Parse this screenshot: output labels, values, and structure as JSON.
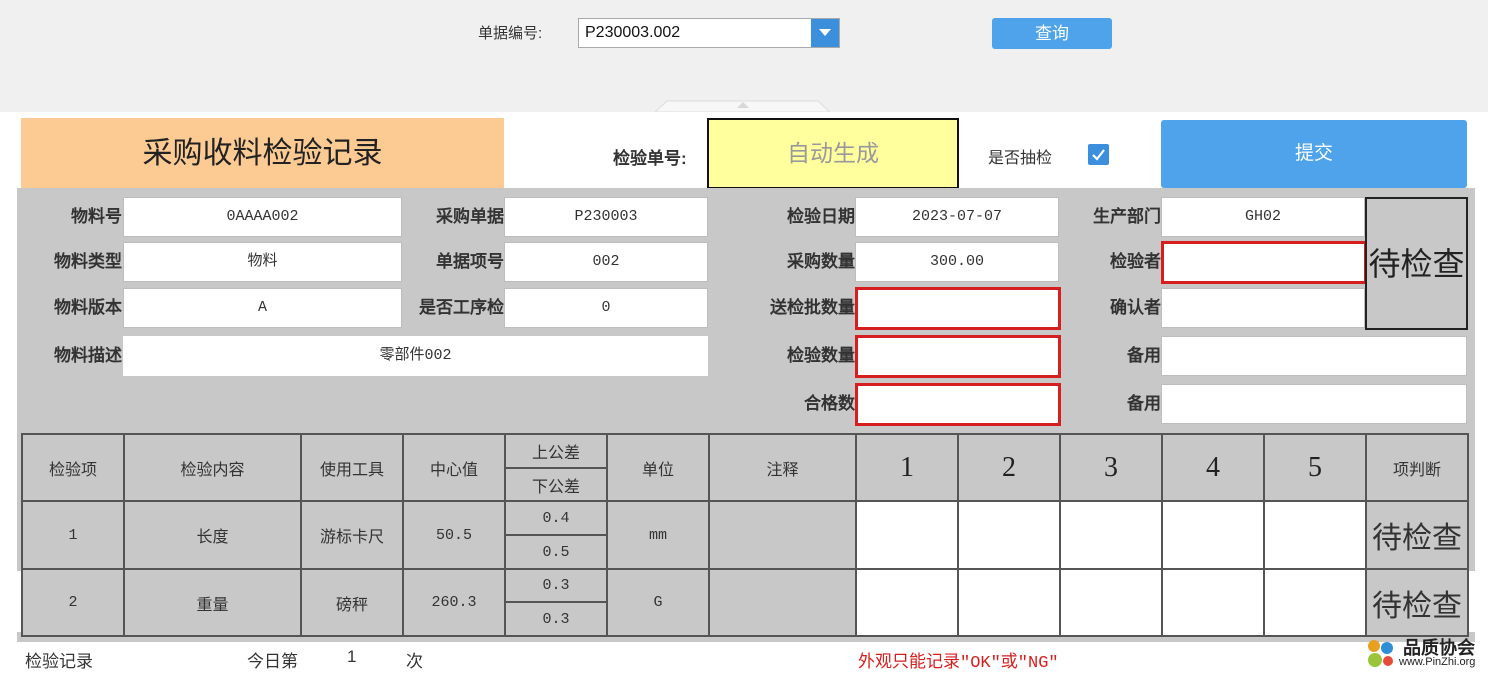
{
  "query": {
    "doc_no_label": "单据编号:",
    "doc_no_value": "P230003.002",
    "query_button": "查询"
  },
  "header": {
    "title": "采购收料检验记录",
    "inspection_no_label": "检验单号:",
    "inspection_no_value": "自动生成",
    "sampling_label": "是否抽检",
    "sampling_checked": true,
    "submit_button": "提交"
  },
  "fields": {
    "material_no_label": "物料号",
    "material_no": "0AAAA002",
    "material_type_label": "物料类型",
    "material_type": "物料",
    "material_version_label": "物料版本",
    "material_version": "A",
    "material_desc_label": "物料描述",
    "material_desc": "零部件002",
    "purchase_order_label": "采购单据",
    "purchase_order": "P230003",
    "order_item_label": "单据项号",
    "order_item": "002",
    "process_check_label": "是否工序检",
    "process_check": "0",
    "inspect_date_label": "检验日期",
    "inspect_date": "2023-07-07",
    "purchase_qty_label": "采购数量",
    "purchase_qty": "300.00",
    "batch_qty_label": "送检批数量",
    "batch_qty": "",
    "inspect_qty_label": "检验数量",
    "inspect_qty": "",
    "pass_qty_label": "合格数",
    "pass_qty": "",
    "dept_label": "生产部门",
    "dept": "GH02",
    "inspector_label": "检验者",
    "inspector": "",
    "confirmer_label": "确认者",
    "confirmer": "",
    "spare1_label": "备用",
    "spare1": "",
    "spare2_label": "备用",
    "spare2": "",
    "status": "待检查"
  },
  "table": {
    "headers": {
      "item": "检验项",
      "content": "检验内容",
      "tool": "使用工具",
      "center": "中心值",
      "upper": "上公差",
      "lower": "下公差",
      "unit": "单位",
      "note": "注释",
      "s1": "1",
      "s2": "2",
      "s3": "3",
      "s4": "4",
      "s5": "5",
      "judge": "项判断"
    },
    "rows": [
      {
        "item": "1",
        "content": "长度",
        "tool": "游标卡尺",
        "center": "50.5",
        "upper": "0.4",
        "lower": "0.5",
        "unit": "mm",
        "note": "",
        "judge": "待检查"
      },
      {
        "item": "2",
        "content": "重量",
        "tool": "磅秤",
        "center": "260.3",
        "upper": "0.3",
        "lower": "0.3",
        "unit": "G",
        "note": "",
        "judge": "待检查"
      }
    ]
  },
  "footer": {
    "record_label": "检验记录",
    "today_label": "今日第",
    "today_count": "1",
    "times_label": "次",
    "note": "外观只能记录\"OK\"或\"NG\"",
    "logo_title": "品质协会",
    "logo_url": "www.PinZhi.org"
  },
  "colors": {
    "accent": "#4ea3ea",
    "title_bg": "#fccb94",
    "auto_bg": "#ffff9e",
    "required_border": "#d61e1e",
    "panel_gray": "#c8c8c8"
  }
}
